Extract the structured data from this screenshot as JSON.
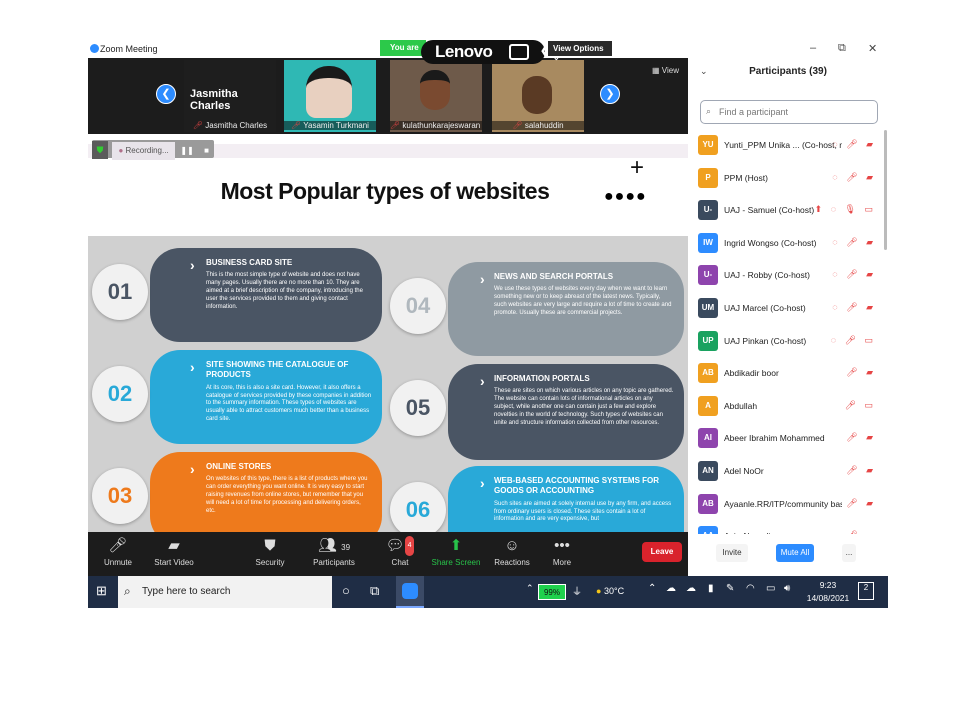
{
  "window": {
    "title": "Zoom Meeting",
    "minimize": "–",
    "restore": "⧉",
    "close": "✕"
  },
  "top_overlay": {
    "you_are": "You are",
    "lenovo": "Lenovo",
    "view_options": "View Options ⌄"
  },
  "video_strip": {
    "active_speaker": "Jasmitha Charles",
    "view_label": "View",
    "tiles": [
      {
        "name": "Jasmitha Charles",
        "color": "#1e1e1e"
      },
      {
        "name": "Yasamin Turkmani",
        "color": "#2fb8b4"
      },
      {
        "name": "kulathunkarajeswaran ...",
        "color": "#6e5a4a"
      },
      {
        "name": "salahuddin",
        "color": "#a88a60"
      }
    ]
  },
  "recording": {
    "label": "Recording..."
  },
  "slide": {
    "title": "Most Popular types of websites",
    "plus": "+",
    "dots": "●●●●",
    "items": [
      {
        "num": "01",
        "title": "BUSINESS CARD SITE",
        "text": "This is the most simple type of website and does not have many pages. Usually there are no more than 10. They are aimed at a brief description of the company, introducing the user the services provided to them and giving contact information.",
        "color": "#4a5564",
        "numcolor": "#4a5564"
      },
      {
        "num": "02",
        "title": "SITE SHOWING THE CATALOGUE OF PRODUCTS",
        "text": "At its core, this is also a site card. However, it also offers a catalogue of services provided by these companies in addition to the summary information. These types of websites are usually able to attract customers much better than a business card site.",
        "color": "#29a9d8",
        "numcolor": "#29a9d8"
      },
      {
        "num": "03",
        "title": "ONLINE STORES",
        "text": "On websites of this type, there is a list of products where you can order everything you want online. It is very easy to start raising revenues from online stores, but remember that you will need a lot of time for processing and delivering orders, etc.",
        "color": "#ee7a1c",
        "numcolor": "#ee7a1c"
      },
      {
        "num": "04",
        "title": "NEWS AND SEARCH PORTALS",
        "text": "We use these types of websites every day when we want to learn something new or to keep abreast of the latest news. Typically, such websites are very large and require a lot of time to create and promote. Usually these are commercial projects.",
        "color": "#8f9aa2",
        "numcolor": "#b0b8be"
      },
      {
        "num": "05",
        "title": "INFORMATION PORTALS",
        "text": "These are sites on which various articles on any topic are gathered. The website can contain lots of informational articles on any subject, while another one can contain just a few and explore novelties in the world of technology. Such types of websites can unite and structure information collected from other resources.",
        "color": "#4a5564",
        "numcolor": "#4a5564"
      },
      {
        "num": "06",
        "title": "WEB-BASED ACCOUNTING SYSTEMS FOR GOODS OR ACCOUNTING",
        "text": "Such sites are aimed at solely internal use by any firm, and access from ordinary users is closed. These sites contain a lot of information and are very expensive, but",
        "color": "#29a9d8",
        "numcolor": "#29a9d8"
      }
    ]
  },
  "toolbar": {
    "unmute": "Unmute",
    "start_video": "Start Video",
    "security": "Security",
    "participants": "Participants",
    "participants_count": "39",
    "chat": "Chat",
    "chat_badge": "4",
    "share_screen": "Share Screen",
    "reactions": "Reactions",
    "more": "More",
    "leave": "Leave"
  },
  "participants_panel": {
    "title": "Participants (39)",
    "search_placeholder": "Find a participant",
    "list": [
      {
        "initials": "YU",
        "name": "Yunti_PPM Unika ... (Co-host, me)",
        "color": "#f0a020"
      },
      {
        "initials": "P",
        "name": "PPM (Host)",
        "color": "#f0a020"
      },
      {
        "initials": "U-",
        "name": "UAJ - Samuel (Co-host)",
        "color": "#3a4a5e"
      },
      {
        "initials": "IW",
        "name": "Ingrid Wongso (Co-host)",
        "color": "#2d8cff"
      },
      {
        "initials": "U-",
        "name": "UAJ - Robby (Co-host)",
        "color": "#8e44ad"
      },
      {
        "initials": "UM",
        "name": "UAJ Marcel (Co-host)",
        "color": "#3a4a5e"
      },
      {
        "initials": "UP",
        "name": "UAJ Pinkan (Co-host)",
        "color": "#1aa260"
      },
      {
        "initials": "AB",
        "name": "Abdikadir boor",
        "color": "#f0a020"
      },
      {
        "initials": "A",
        "name": "Abdullah",
        "color": "#f0a020"
      },
      {
        "initials": "AI",
        "name": "Abeer Ibrahim Mohammed",
        "color": "#8e44ad"
      },
      {
        "initials": "AN",
        "name": "Adel NoOr",
        "color": "#3a4a5e"
      },
      {
        "initials": "AB",
        "name": "Ayaanle.RR/ITP/community bas...",
        "color": "#8e44ad"
      },
      {
        "initials": "AA",
        "name": "Aziz Alnoodin",
        "color": "#2d8cff"
      }
    ],
    "invite": "Invite",
    "mute_all": "Mute All",
    "more": "..."
  },
  "taskbar": {
    "search_placeholder": "Type here to search",
    "battery": "99%",
    "temperature": "30°C",
    "time": "9:23",
    "date": "14/08/2021",
    "notifications": "2"
  }
}
